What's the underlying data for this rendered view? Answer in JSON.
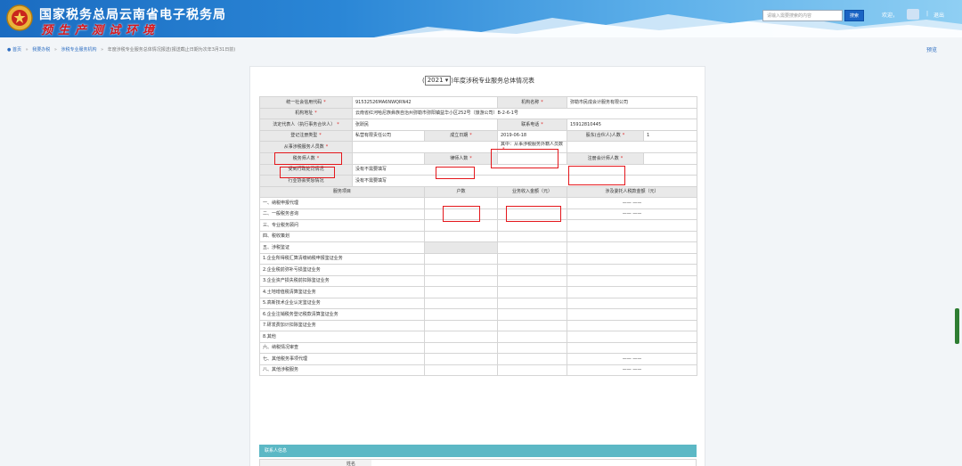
{
  "header": {
    "site_title": "国家税务总局云南省电子税务局",
    "env_title": "预生产测试环境",
    "search_placeholder": "请输入需要搜索的内容",
    "search_button": "搜索",
    "welcome": "欢迎，",
    "separator": "|",
    "logout": "退出"
  },
  "breadcrumb": {
    "items": [
      "首页",
      "我要办税",
      "涉税专业服务机构",
      "年度涉税专业服务总体情况报送(报送截止日期为次年3月31日前)"
    ],
    "separator": "»"
  },
  "preview_label": "预览",
  "form": {
    "title_prefix": "(",
    "year": "2021",
    "title_suffix": ")年度涉税专业服务总体情况表",
    "required_mark": "*",
    "rows": {
      "credit_code_label": "统一社会信用代码",
      "credit_code_value": "91532526MA6NWQRN42",
      "org_name_label": "机构名称",
      "org_name_value": "弥勒市民成会计服务有限公司",
      "address_label": "机构地址",
      "address_value": "云南省红河哈尼族彝族自治州弥勒市弥阳镇益华小区252号（旅游公司）B-2-6-1号",
      "legal_rep_label": "法定代表人（执行事务合伙人）",
      "legal_rep_value": "张跃民",
      "phone_label": "联系电话",
      "phone_value": "15912810445",
      "reg_type_label": "登记注册类型",
      "reg_type_value": "私营有限责任公司",
      "est_date_label": "成立日期",
      "est_date_value": "2019-06-18",
      "shareholder_label": "股东(合伙人)人数",
      "shareholder_value": "1",
      "staff_label": "从事涉税服务人员数",
      "staff_sub_label": "其中：从事涉税服务外籍人员数",
      "tax_agent_label": "税务师人数",
      "lawyer_label": "律师人数",
      "cpa_label": "注册会计师人数",
      "admin_penalty_label": "受到行政处罚情况",
      "admin_penalty_hint": "没有不需要填写",
      "assoc_discipline_label": "行业协会奖惩情况",
      "assoc_discipline_hint": "没有不需要填写"
    },
    "columns": {
      "service_item": "服务项目",
      "households": "户数",
      "revenue": "业务收入金额（元）",
      "involved_tax": "涉及委托人税款金额（元）"
    },
    "dash": "—— ——",
    "services": [
      "一、纳税申报代理",
      "二、一般税务咨询",
      "三、专业税务顾问",
      "四、税收策划",
      "五、涉税鉴证",
      "1.企业所得税汇算清缴纳税申报鉴证业务",
      "2.企业税前弥补亏损鉴证业务",
      "3.企业资产损失税前扣除鉴证业务",
      "4.土地增值税清算鉴证业务",
      "5.高新技术企业认定鉴证业务",
      "6.企业注销税务登记税款清算鉴证业务",
      "7.研发费加计扣除鉴证业务",
      "8.其他",
      "六、纳税情况审查",
      "七、其他税务事项代理",
      "八、其他涉税服务"
    ],
    "contact": {
      "section_title": "联系人信息",
      "name_label": "姓名"
    }
  }
}
